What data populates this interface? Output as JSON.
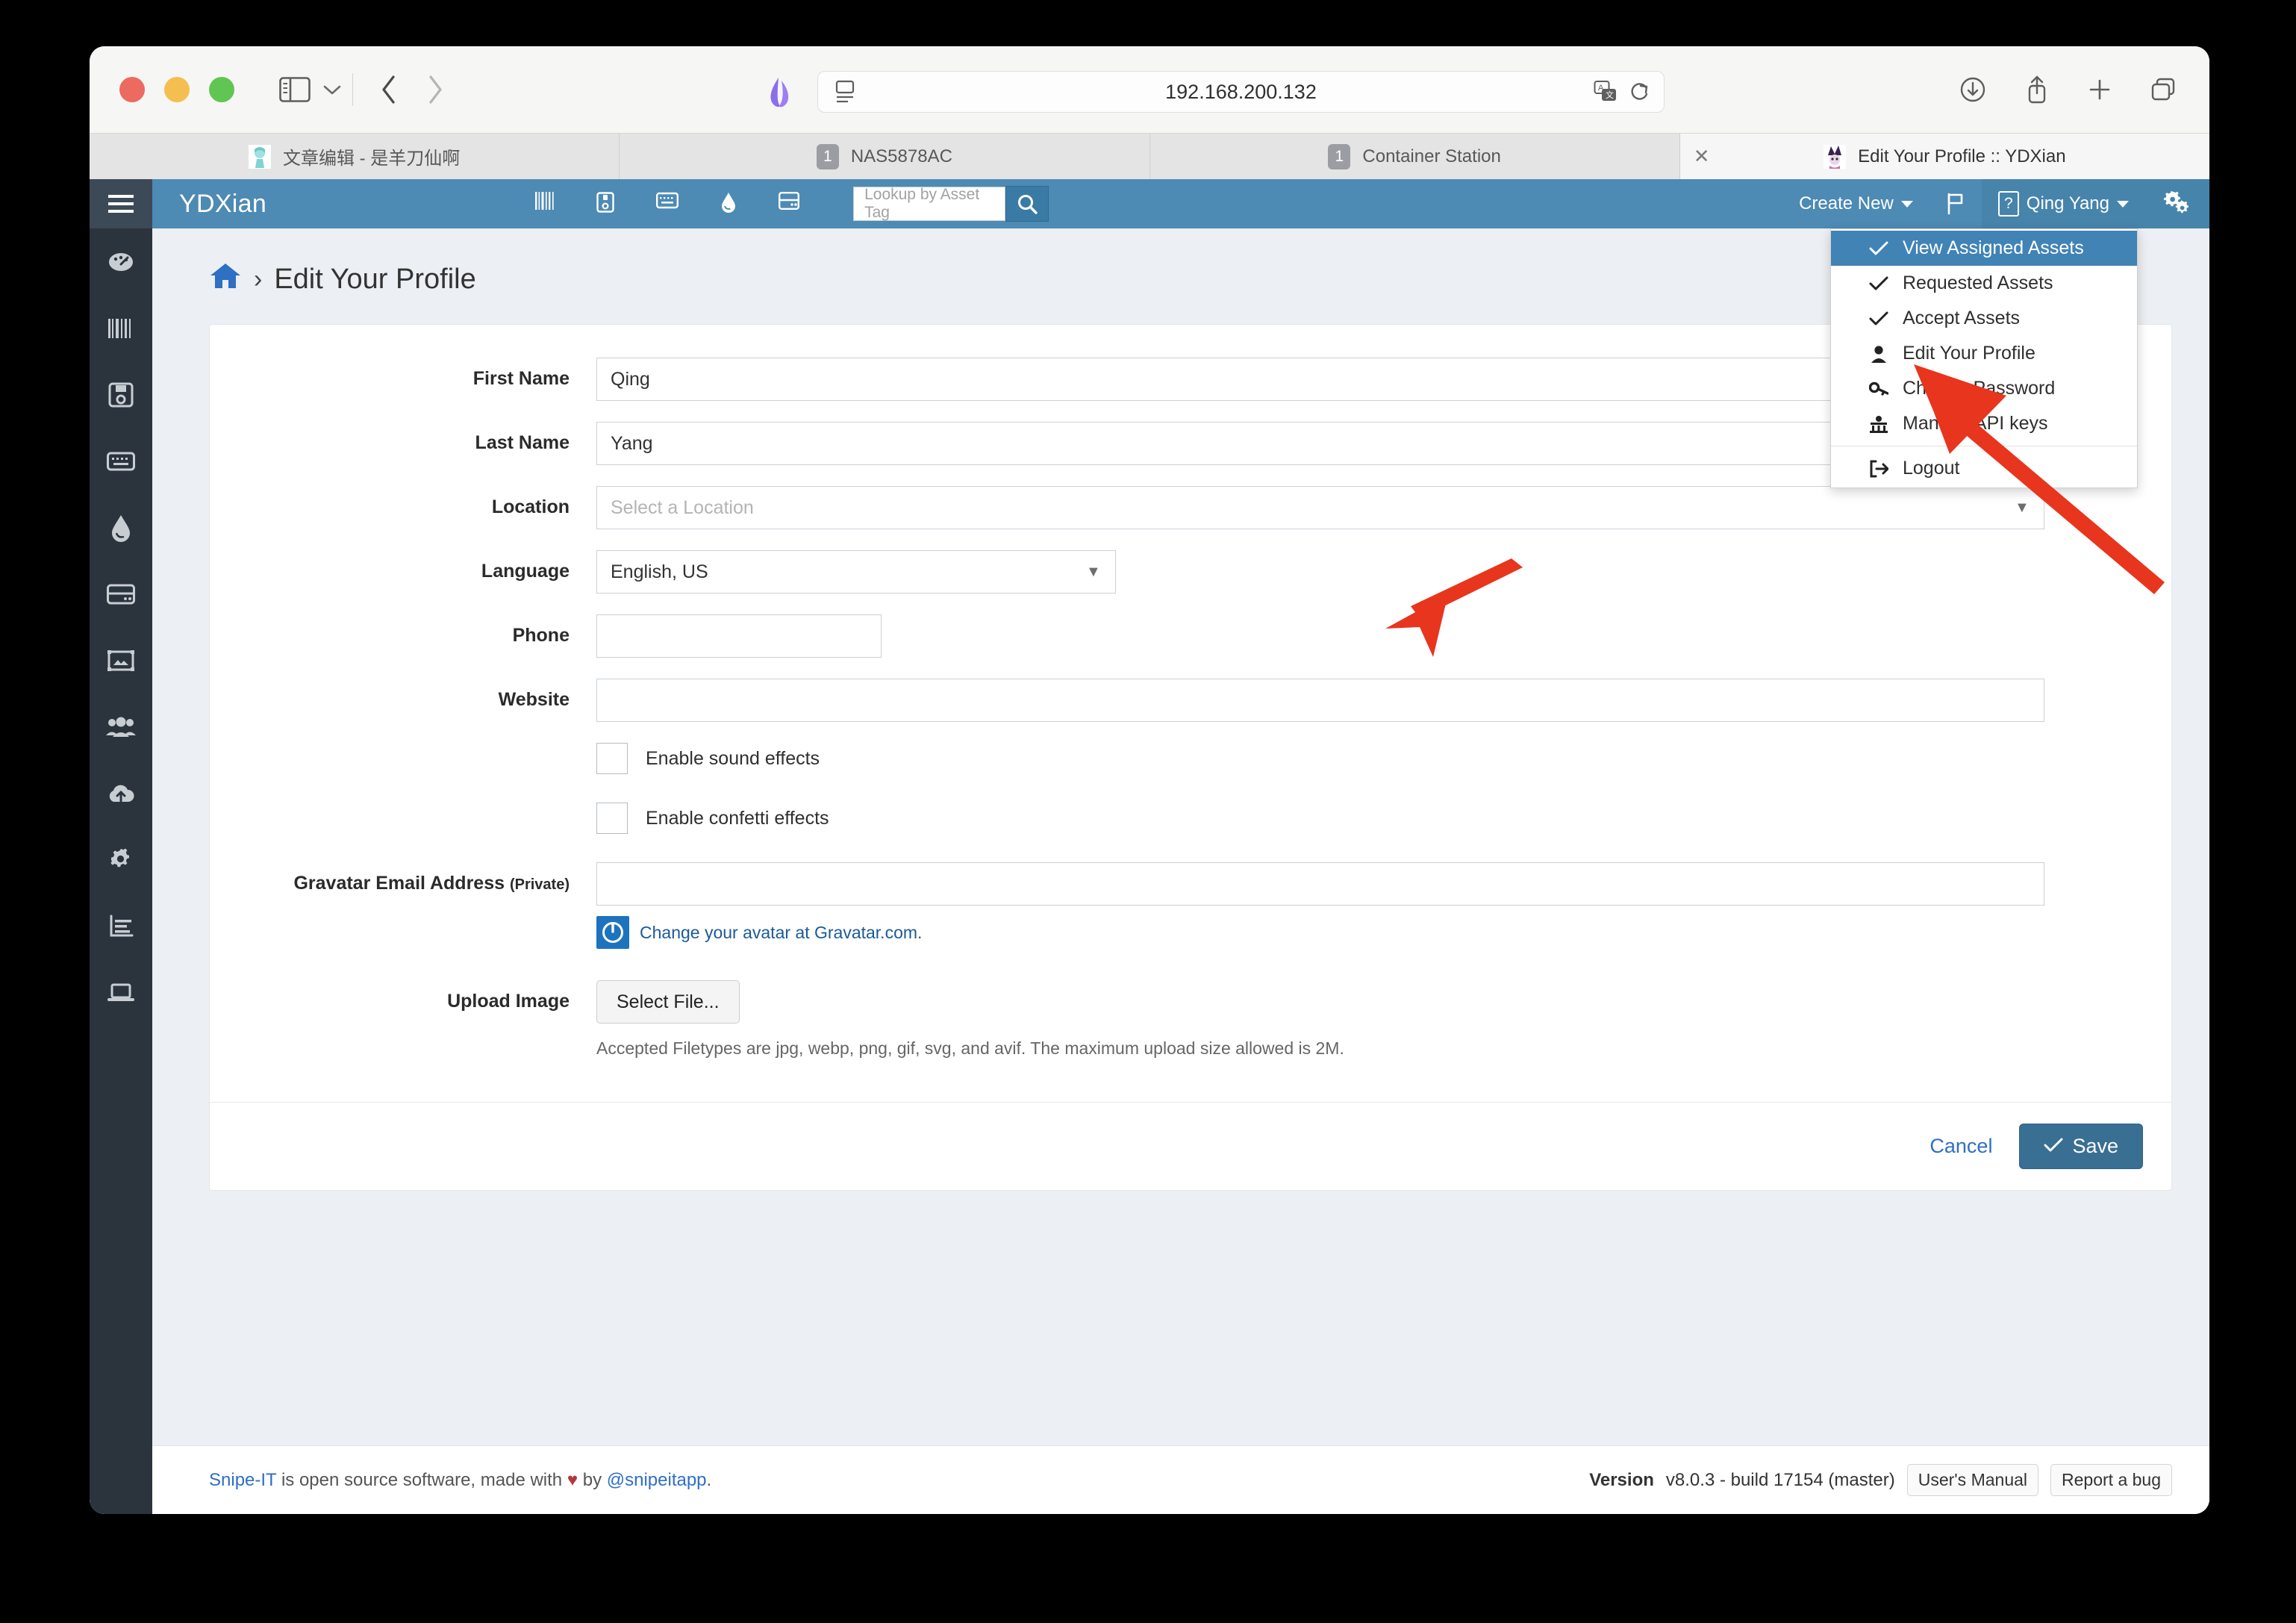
{
  "browser": {
    "url": "192.168.200.132",
    "tabs": [
      {
        "title": "文章编辑 - 是羊刀仙啊",
        "badge": "",
        "favicon": "miku-favicon",
        "active": false
      },
      {
        "title": "NAS5878AC",
        "badge": "1",
        "favicon": "number-badge",
        "active": false
      },
      {
        "title": "Container Station",
        "badge": "1",
        "favicon": "number-badge",
        "active": false
      },
      {
        "title": "Edit Your Profile :: YDXian",
        "badge": "",
        "favicon": "ydxian-favicon",
        "active": true
      }
    ],
    "toolbar_icons": [
      "sidebar-icon",
      "chevron-down-icon",
      "back-icon",
      "forward-icon",
      "downloads-icon",
      "share-icon",
      "new-tab-icon",
      "tab-overview-icon"
    ],
    "url_icons": [
      "reader-view-icon",
      "translate-icon",
      "reload-icon"
    ]
  },
  "app": {
    "brand": "YDXian",
    "hamburger": "hamburger-icon",
    "header_icons": [
      "barcode-icon",
      "floppy-disk-icon",
      "keyboard-icon",
      "droplet-icon",
      "server-icon"
    ],
    "search": {
      "placeholder": "Lookup by Asset Tag",
      "button_icon": "search-icon"
    },
    "create_new": "Create New",
    "flag_icon": "flag-icon",
    "user_name": "Qing Yang",
    "avatar_placeholder": "?",
    "gears_icon": "gears-icon",
    "accent": "#4d8ab4",
    "rail_items": [
      "dashboard-icon",
      "barcode-icon",
      "floppy-disk-icon",
      "keyboard-icon",
      "droplet-icon",
      "server-icon",
      "license-icon",
      "people-icon",
      "cloud-upload-icon",
      "gear-icon",
      "bar-chart-icon",
      "laptop-icon"
    ]
  },
  "dropdown": {
    "items": [
      {
        "label": "View Assigned Assets",
        "icon": "check-icon",
        "selected": true
      },
      {
        "label": "Requested Assets",
        "icon": "check-icon",
        "selected": false
      },
      {
        "label": "Accept Assets",
        "icon": "check-icon",
        "selected": false
      },
      {
        "label": "Edit Your Profile",
        "icon": "user-icon",
        "selected": false
      },
      {
        "label": "Change Password",
        "icon": "key-icon",
        "selected": false
      },
      {
        "label": "Manage API keys",
        "icon": "api-key-icon",
        "selected": false
      },
      {
        "label": "Logout",
        "icon": "logout-icon",
        "selected": false
      }
    ]
  },
  "page": {
    "home_icon": "home-icon",
    "separator": "›",
    "title": "Edit Your Profile",
    "fields": {
      "first_name": {
        "label": "First Name",
        "value": "Qing"
      },
      "last_name": {
        "label": "Last Name",
        "value": "Yang"
      },
      "location": {
        "label": "Location",
        "placeholder": "Select a Location",
        "value": ""
      },
      "language": {
        "label": "Language",
        "value": "English, US"
      },
      "phone": {
        "label": "Phone",
        "value": ""
      },
      "website": {
        "label": "Website",
        "value": ""
      },
      "gravatar": {
        "label": "Gravatar Email Address",
        "label_sub": "(Private)",
        "value": ""
      },
      "upload": {
        "label": "Upload Image",
        "button": "Select File..."
      }
    },
    "checkboxes": [
      {
        "label": "Enable sound effects",
        "checked": false
      },
      {
        "label": "Enable confetti effects",
        "checked": false
      }
    ],
    "gravatar_link": "Change your avatar at Gravatar.com.",
    "accepted_filetypes": "Accepted Filetypes are jpg, webp, png, gif, svg, and avif. The maximum upload size allowed is 2M.",
    "cancel": "Cancel",
    "save": "Save"
  },
  "footer": {
    "brand": "Snipe-IT",
    "text_mid": " is open source software, made with ",
    "heart": "♥",
    "text_by": " by ",
    "handle": "@snipeitapp",
    "period": ".",
    "version_label": "Version",
    "version_value": "v8.0.3 - build 17154 (master)",
    "manual": "User's Manual",
    "report": "Report a bug"
  },
  "annotations": {
    "arrow_color": "#e8351e",
    "arrows": [
      {
        "name": "arrow-to-language-field"
      },
      {
        "name": "arrow-to-edit-your-profile-menu-item"
      }
    ]
  }
}
